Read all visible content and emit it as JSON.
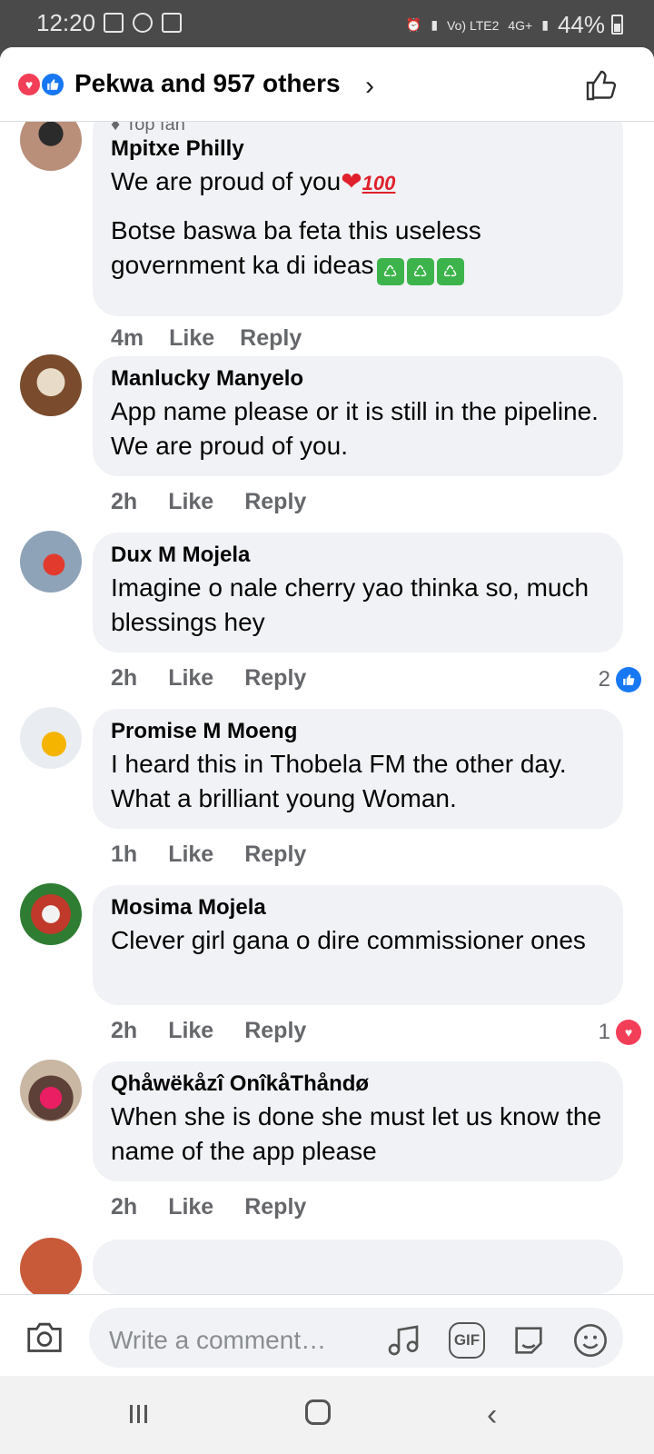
{
  "status_bar": {
    "time": "12:20",
    "network": "Vo) LTE2",
    "network_type": "4G+",
    "battery": "44%"
  },
  "header": {
    "reactions_summary": "Pekwa and 957 others",
    "reaction_icons": [
      "love-icon",
      "like-icon"
    ]
  },
  "comments": [
    {
      "badge": "Top fan",
      "author": "Mpitxe Philly",
      "text_line1": "We are proud of you",
      "text_line1_emoji": "❤",
      "text_hundred": "100",
      "text_line2": "Botse baswa ba feta this useless government ka di ideas",
      "time": "4m",
      "like": "Like",
      "reply": "Reply"
    },
    {
      "author": "Manlucky Manyelo",
      "text": "App name please or it is still in the pipeline. We are proud of you.",
      "time": "2h",
      "like": "Like",
      "reply": "Reply"
    },
    {
      "author": "Dux M Mojela",
      "text": "Imagine o nale cherry yao thinka so, much blessings hey",
      "time": "2h",
      "like": "Like",
      "reply": "Reply",
      "reaction_count": "2",
      "reaction_type": "like"
    },
    {
      "author": "Promise M Moeng",
      "text": "I heard this in Thobela FM the other day. What a brilliant young Woman.",
      "time": "1h",
      "like": "Like",
      "reply": "Reply"
    },
    {
      "author": "Mosima Mojela",
      "text": "Clever girl gana o dire commissioner ones",
      "time": "2h",
      "like": "Like",
      "reply": "Reply",
      "reaction_count": "1",
      "reaction_type": "love"
    },
    {
      "author": "Qhåwëkåzî OnîkåThåndø",
      "text": "When she is done she must let us know the name of the app please",
      "time": "2h",
      "like": "Like",
      "reply": "Reply"
    }
  ],
  "composer": {
    "placeholder": "Write a comment…",
    "gif_label": "GIF"
  },
  "colors": {
    "accent_blue": "#1877f2",
    "love_red": "#f33e58",
    "bubble_bg": "#f0f2f5",
    "meta_gray": "#65676b"
  }
}
